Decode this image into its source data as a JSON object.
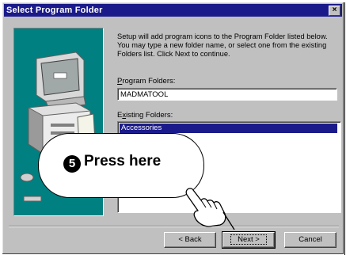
{
  "window": {
    "title": "Select Program Folder",
    "close_glyph": "×"
  },
  "description": "Setup will add program icons to the Program Folder listed below. You may type a new folder name, or select one from the existing Folders list. Click Next to continue.",
  "program_folders": {
    "label_first": "P",
    "label_rest": "rogram Folders:",
    "value": "MADMATOOL"
  },
  "existing_folders": {
    "label_first": "x",
    "label_prefix": "E",
    "label_rest": "isting Folders:",
    "items": [
      "Accessories"
    ]
  },
  "buttons": {
    "back": "< Back",
    "next": "Next >",
    "cancel": "Cancel"
  },
  "callout": {
    "number": "5",
    "text": "Press here"
  },
  "colors": {
    "title_bar": "#1a1a8a",
    "panel": "#008080",
    "dialog": "#c0c0c0"
  },
  "icons": {
    "art": "computer-setup-illustration",
    "pointer": "pointing-hand-icon"
  }
}
